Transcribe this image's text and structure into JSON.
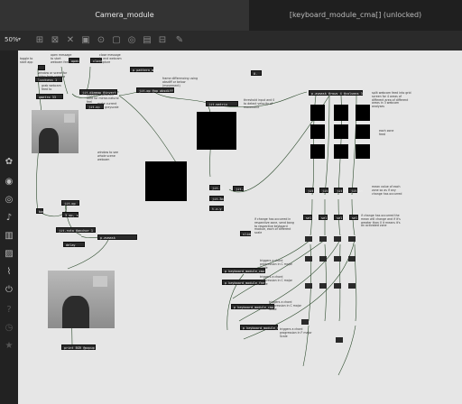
{
  "tabs": {
    "active": "Camera_module",
    "inactive": "[keyboard_module_cma[] (unlocked)"
  },
  "toolbar": {
    "zoom": "50%",
    "icons": [
      "grid-icon",
      "close-box-icon",
      "x-icon",
      "square-icon",
      "circle-box-icon",
      "lock-icon",
      "ring-icon",
      "box-icon",
      "grid2-icon",
      "paint-icon"
    ]
  },
  "left_icons": [
    "add-icon",
    "info-icon",
    "target-icon",
    "music-icon",
    "keys-icon",
    "picture-icon",
    "clip-icon",
    "plug-icon",
    "help-icon",
    "history-icon",
    "star-icon"
  ],
  "objects": {
    "toggle": "",
    "loadbang": "loadmess 1",
    "qmetro": "qmetro 33",
    "grab": "jit.grab @unique",
    "dimbox": "jit.op",
    "scale": "jit.dimmap @invert 1",
    "framediff": "jit.op @op absdiff",
    "polygon": "p pattern_mosq",
    "matrix": "jit.matrix",
    "mirror": "jit.op",
    "jit3": "3 op, s",
    "frames": "jit.rota @anchor 1",
    "print": "print BGR @popup 1",
    "routes": "p.avmask @rows 4 @columns 3",
    "shapes": "t.x.y",
    "ranges": "jit.3m",
    "loop1": "sel 1",
    "loop2": "p keyboard_module_cma",
    "loop3": "p keyboard_module_fmaj",
    "loop4": "p keyboard_module_cma",
    "loop5": "p keyboard_module_fmaj",
    "slide": "slide 10",
    "o1": "jit.3m",
    "o2": "jit.3m",
    "scope": "p.avmask",
    "num": "0.",
    "o3": "sel 1",
    "o4": "delay",
    "o5": "bang",
    "o6": "open",
    "o7": "close",
    "o8": "jit.3m",
    "o9": "jit.3m",
    "o10": "jit.3m",
    "o11": "jit.3m"
  },
  "comments": {
    "c1": "toggle to start app",
    "c2": "open message to start webcam feed",
    "c3": "close message to end webcam capture",
    "c4": "grab webcam feed to",
    "c5": "window or scene for video from camera source",
    "c6": "invert the webcam feed for mirror-natural feel",
    "c7": "make current feed grayscale",
    "c8": "frame differencing using absdiff or below (movement)",
    "c9": "threshold input and 0 to detect velocity of movement",
    "c10": "split webcam feed into grid screen for 4 areas of different area of different areas in 3 webcam analyses",
    "c11": "each zone feed",
    "c12": "window to see whole scene webcam",
    "c13": "mean value of each zone so as if any change has occurred",
    "c14": "if change has occurred in respective zone, send bang to respective keyboard module, each of different scale",
    "c15": "if change has occurred the mean will change and if it's greater than 0 it means it's an activated zone",
    "c16": "triggers a chord progression in C major Scale",
    "c17": "triggers a chord progression in C major Scale",
    "c18": "triggers a chord progression in C major Scale",
    "c19": "triggers a chord progression in F major Scale"
  }
}
